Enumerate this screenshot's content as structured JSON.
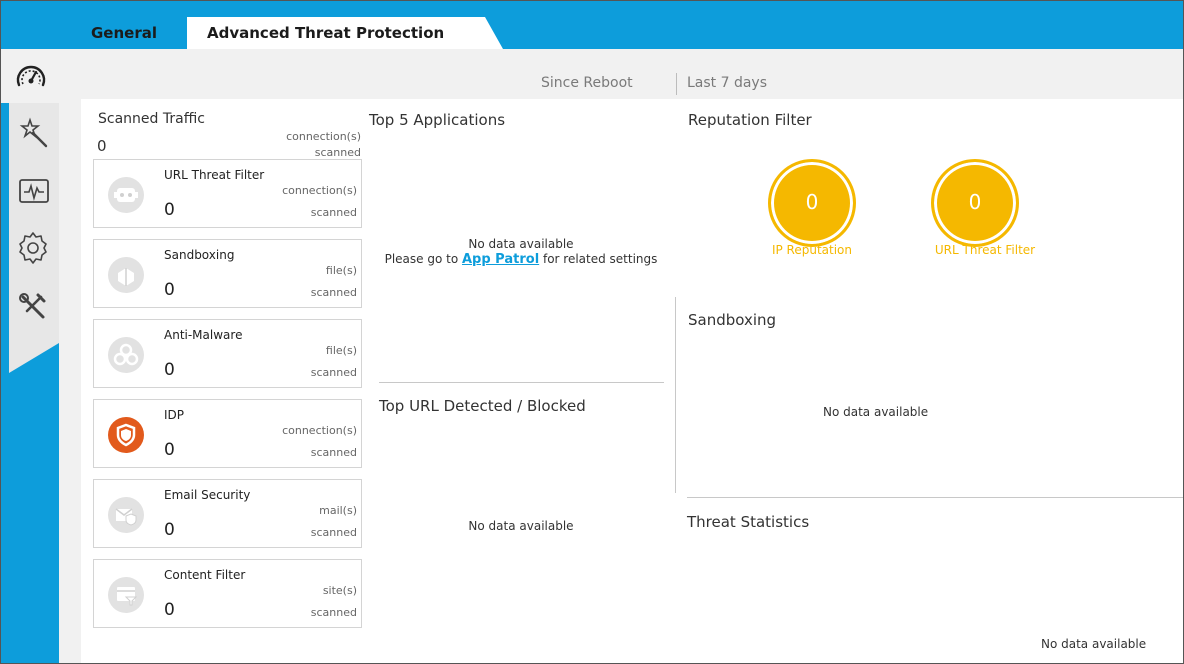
{
  "tabs": [
    {
      "label": "General"
    },
    {
      "label": "Advanced Threat Protection"
    }
  ],
  "header": {
    "since_reboot": "Since Reboot",
    "last_7_days": "Last 7 days"
  },
  "sidebar": {
    "items": [
      {
        "icon": "dashboard-gauge-icon"
      },
      {
        "icon": "wizard-wand-icon"
      },
      {
        "icon": "monitor-pulse-icon"
      },
      {
        "icon": "gear-icon"
      },
      {
        "icon": "maintenance-tools-icon"
      }
    ]
  },
  "scanned_traffic": {
    "title": "Scanned Traffic",
    "count": "0",
    "unit_line1": "connection(s)",
    "unit_line2": "scanned"
  },
  "cards": [
    {
      "name": "URL Threat Filter",
      "count": "0",
      "unit": "connection(s)",
      "suffix": "scanned",
      "icon": "robot-face-icon"
    },
    {
      "name": "Sandboxing",
      "count": "0",
      "unit": "file(s)",
      "suffix": "scanned",
      "icon": "sandbox-box-icon"
    },
    {
      "name": "Anti-Malware",
      "count": "0",
      "unit": "file(s)",
      "suffix": "scanned",
      "icon": "biohazard-icon"
    },
    {
      "name": "IDP",
      "count": "0",
      "unit": "connection(s)",
      "suffix": "scanned",
      "icon": "shield-icon"
    },
    {
      "name": "Email Security",
      "count": "0",
      "unit": "mail(s)",
      "suffix": "scanned",
      "icon": "email-shield-icon"
    },
    {
      "name": "Content Filter",
      "count": "0",
      "unit": "site(s)",
      "suffix": "scanned",
      "icon": "web-filter-icon"
    }
  ],
  "top_apps": {
    "title": "Top 5 Applications",
    "no_data": "No data available",
    "hint_prefix": "Please go to ",
    "hint_link": "App Patrol",
    "hint_suffix": " for related settings"
  },
  "top_url": {
    "title": "Top URL Detected / Blocked",
    "no_data": "No data available"
  },
  "reputation": {
    "title": "Reputation Filter",
    "ip_value": "0",
    "ip_label": "IP Reputation",
    "url_value": "0",
    "url_label": "URL Threat Filter",
    "accent": "#f5b800"
  },
  "sandboxing": {
    "title": "Sandboxing",
    "no_data": "No data available"
  },
  "threat_stats": {
    "title": "Threat Statistics",
    "no_data": "No data available"
  },
  "colors": {
    "brand_blue": "#0d9ddb",
    "idp_orange": "#e25a1c",
    "gauge_yellow": "#f5b800"
  }
}
